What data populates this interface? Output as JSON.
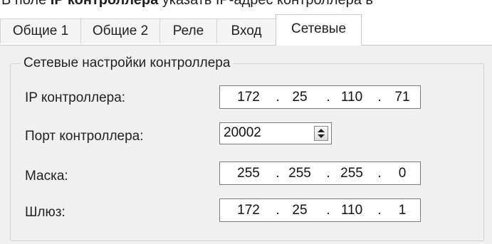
{
  "doc": {
    "prefix": "В поле ",
    "bold": "IP контроллера",
    "suffix": " указать IP-адрес контроллера в"
  },
  "tabs": [
    {
      "label": "Общие 1",
      "active": false
    },
    {
      "label": "Общие 2",
      "active": false
    },
    {
      "label": "Реле",
      "active": false
    },
    {
      "label": "Вход",
      "active": false
    },
    {
      "label": "Сетевые",
      "active": true
    }
  ],
  "group": {
    "title": "Сетевые настройки контроллера",
    "ip_label": "IP контроллера:",
    "ip": [
      "172",
      "25",
      "110",
      "71"
    ],
    "port_label": "Порт контроллера:",
    "port": "20002",
    "mask_label": "Маска:",
    "mask": [
      "255",
      "255",
      "255",
      "0"
    ],
    "gateway_label": "Шлюз:",
    "gateway": [
      "172",
      "25",
      "110",
      "1"
    ],
    "ip_separator": "."
  }
}
